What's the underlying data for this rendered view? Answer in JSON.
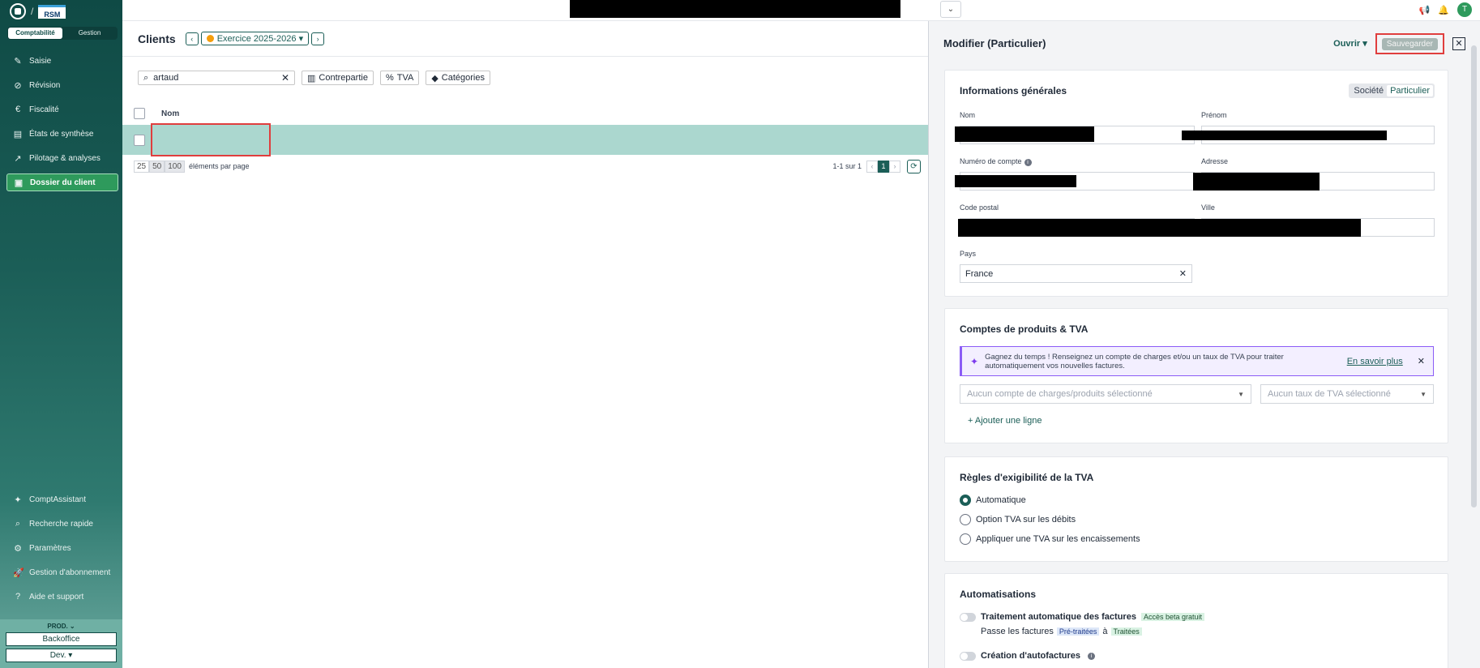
{
  "sidebar": {
    "toggle": {
      "left": "Comptabilité",
      "right": "Gestion"
    },
    "logo_text": "RSM",
    "items": [
      {
        "label": "Saisie",
        "icon": "✎"
      },
      {
        "label": "Révision",
        "icon": "⊘"
      },
      {
        "label": "Fiscalité",
        "icon": "€"
      },
      {
        "label": "États de synthèse",
        "icon": "▤"
      },
      {
        "label": "Pilotage & analyses",
        "icon": "↗"
      },
      {
        "label": "Dossier du client",
        "icon": "▣"
      }
    ],
    "bottom_items": [
      {
        "label": "ComptAssistant",
        "icon": "✦"
      },
      {
        "label": "Recherche rapide",
        "icon": "⌕"
      },
      {
        "label": "Paramètres",
        "icon": "⚙"
      },
      {
        "label": "Gestion d'abonnement",
        "icon": "🚀"
      },
      {
        "label": "Aide et support",
        "icon": "?"
      }
    ],
    "env_label": "PROD. ⌄",
    "backoffice": "Backoffice",
    "dev": "Dev. ▾"
  },
  "topbar": {
    "avatar": "T"
  },
  "main": {
    "title": "Clients",
    "exercise": "Exercice 2025-2026 ▾",
    "search_value": "artaud",
    "chips": [
      "Contrepartie",
      "TVA",
      "Catégories"
    ],
    "col_nom": "Nom",
    "page_sizes": [
      "25",
      "50",
      "100"
    ],
    "per_page_label": "éléments par page",
    "range": "1-1 sur 1",
    "current_page": "1"
  },
  "panel": {
    "title": "Modifier (Particulier)",
    "ouvrir": "Ouvrir ▾",
    "save": "Sauvegarder",
    "general": {
      "title": "Informations générales",
      "seg_left": "Société",
      "seg_right": "Particulier",
      "nom": "Nom",
      "prenom": "Prénom",
      "numero": "Numéro de compte",
      "adresse": "Adresse",
      "code_postal": "Code postal",
      "ville": "Ville",
      "pays": "Pays",
      "pays_value": "France"
    },
    "produits": {
      "title": "Comptes de produits & TVA",
      "banner": "Gagnez du temps ! Renseignez un compte de charges et/ou un taux de TVA pour traiter automatiquement vos nouvelles factures.",
      "banner_link": "En savoir plus",
      "select_compte": "Aucun compte de charges/produits sélectionné",
      "select_tva": "Aucun taux de TVA sélectionné",
      "add_line": "+  Ajouter une ligne"
    },
    "regles": {
      "title": "Règles d'exigibilité de la TVA",
      "options": [
        "Automatique",
        "Option TVA sur les débits",
        "Appliquer une TVA sur les encaissements"
      ]
    },
    "auto": {
      "title": "Automatisations",
      "item1": "Traitement automatique des factures",
      "item1_badge": "Accès beta gratuit",
      "item1_sub_a": "Passe les factures",
      "item1_badge_b": "Pré-traitées",
      "item1_sub_c": "à",
      "item1_badge_c": "Traitées",
      "item2": "Création d'autofactures"
    }
  }
}
